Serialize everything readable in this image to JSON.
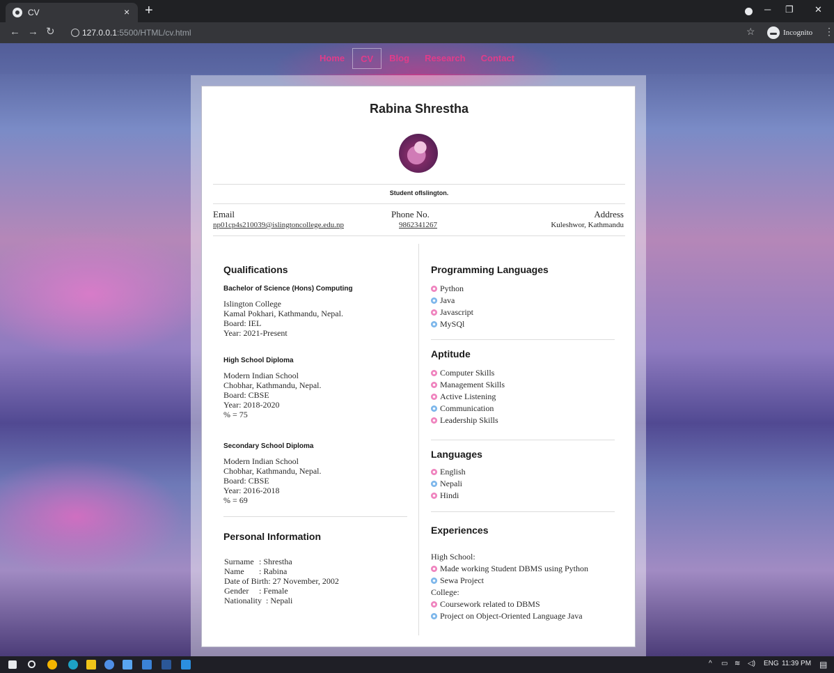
{
  "browser": {
    "tab_title": "CV",
    "url_host": "127.0.0.1",
    "url_rest": ":5500/HTML/cv.html",
    "incognito_label": "Incognito"
  },
  "nav": {
    "items": [
      "Home",
      "CV",
      "Blog",
      "Research",
      "Contact"
    ],
    "active": "CV",
    "link_color": "#e03c8a"
  },
  "profile": {
    "name": "Rabina Shrestha",
    "tagline": "Student ofIslington."
  },
  "contact": {
    "email_label": "Email",
    "email": "np01cp4s210039@islingtoncollege.edu.np",
    "phone_label": "Phone No.",
    "phone": "9862341267",
    "address_label": "Address",
    "address": "Kuleshwor, Kathmandu"
  },
  "qualifications": {
    "heading": "Qualifications",
    "entries": [
      {
        "title": "Bachelor of Science (Hons) Computing",
        "lines": [
          "Islington College",
          "Kamal Pokhari, Kathmandu, Nepal.",
          "Board: IEL",
          "Year: 2021-Present"
        ]
      },
      {
        "title": "High School Diploma",
        "lines": [
          "Modern Indian School",
          "Chobhar, Kathmandu, Nepal.",
          "Board: CBSE",
          "Year: 2018-2020",
          "% = 75"
        ]
      },
      {
        "title": "Secondary School Diploma",
        "lines": [
          "Modern Indian School",
          "Chobhar, Kathmandu, Nepal.",
          "Board: CBSE",
          "Year: 2016-2018",
          "% = 69"
        ]
      }
    ]
  },
  "personal_info": {
    "heading": "Personal Information",
    "rows": [
      {
        "key": "Surname",
        "value": ": Shrestha"
      },
      {
        "key": "Name",
        "value": ": Rabina"
      },
      {
        "key": "Date of Birth",
        "value": ": 27 November, 2002"
      },
      {
        "key": "Gender",
        "value": ": Female"
      },
      {
        "key": "Nationality",
        "value": ": Nepali"
      }
    ]
  },
  "programming_languages": {
    "heading": "Programming Languages",
    "items": [
      "Python",
      "Java",
      "Javascript",
      "MySQl"
    ]
  },
  "aptitude": {
    "heading": "Aptitude",
    "items": [
      "Computer Skills",
      "Management Skills",
      "Active Listening",
      "Communication",
      "Leadership Skills"
    ]
  },
  "languages": {
    "heading": "Languages",
    "items": [
      "English",
      "Nepali",
      "Hindi"
    ]
  },
  "experiences": {
    "heading": "Experiences",
    "high_school_label": "High School:",
    "high_school": [
      "Made working Student DBMS using Python",
      "Sewa Project"
    ],
    "college_label": "College:",
    "college": [
      "Coursework related to DBMS",
      "Project on Object-Oriented Language Java"
    ]
  },
  "taskbar": {
    "lang": "ENG",
    "time": "11:39 PM"
  }
}
